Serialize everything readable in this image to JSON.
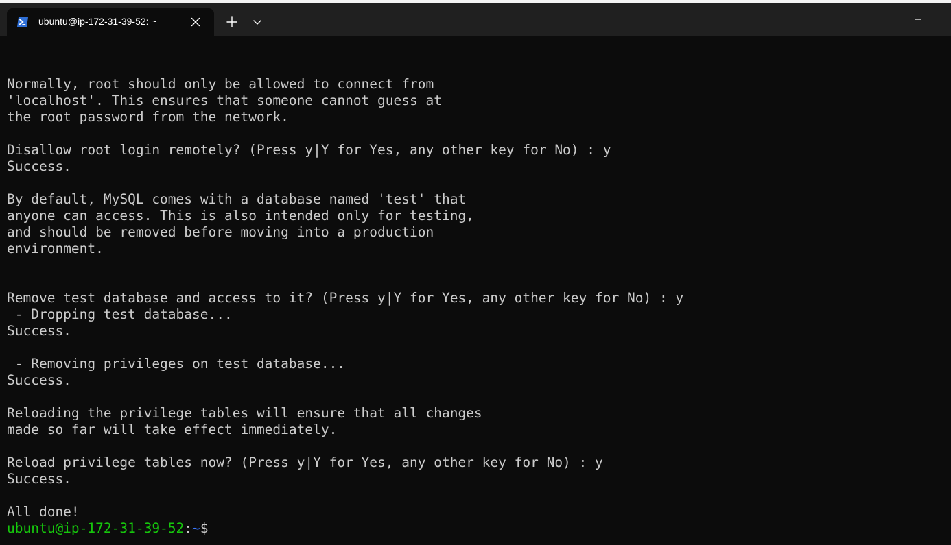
{
  "tab": {
    "title": "ubuntu@ip-172-31-39-52: ~",
    "icon": "powershell-icon"
  },
  "titlebar_controls": {
    "new_tab": "plus-icon",
    "dropdown": "chevron-down-icon",
    "minimize": "minimize-icon"
  },
  "terminal": {
    "lines": [
      "Normally, root should only be allowed to connect from",
      "'localhost'. This ensures that someone cannot guess at",
      "the root password from the network.",
      "",
      "Disallow root login remotely? (Press y|Y for Yes, any other key for No) : y",
      "Success.",
      "",
      "By default, MySQL comes with a database named 'test' that",
      "anyone can access. This is also intended only for testing,",
      "and should be removed before moving into a production",
      "environment.",
      "",
      "",
      "Remove test database and access to it? (Press y|Y for Yes, any other key for No) : y",
      " - Dropping test database...",
      "Success.",
      "",
      " - Removing privileges on test database...",
      "Success.",
      "",
      "Reloading the privilege tables will ensure that all changes",
      "made so far will take effect immediately.",
      "",
      "Reload privilege tables now? (Press y|Y for Yes, any other key for No) : y",
      "Success.",
      "",
      "All done!"
    ],
    "prompt": {
      "user_host": "ubuntu@ip-172-31-39-52",
      "separator": ":",
      "path": "~",
      "symbol": "$"
    }
  },
  "colors": {
    "background": "#0c0c0c",
    "text": "#cccccc",
    "prompt_user": "#16c60c",
    "prompt_path": "#3b78ff",
    "titlebar": "#202020"
  }
}
